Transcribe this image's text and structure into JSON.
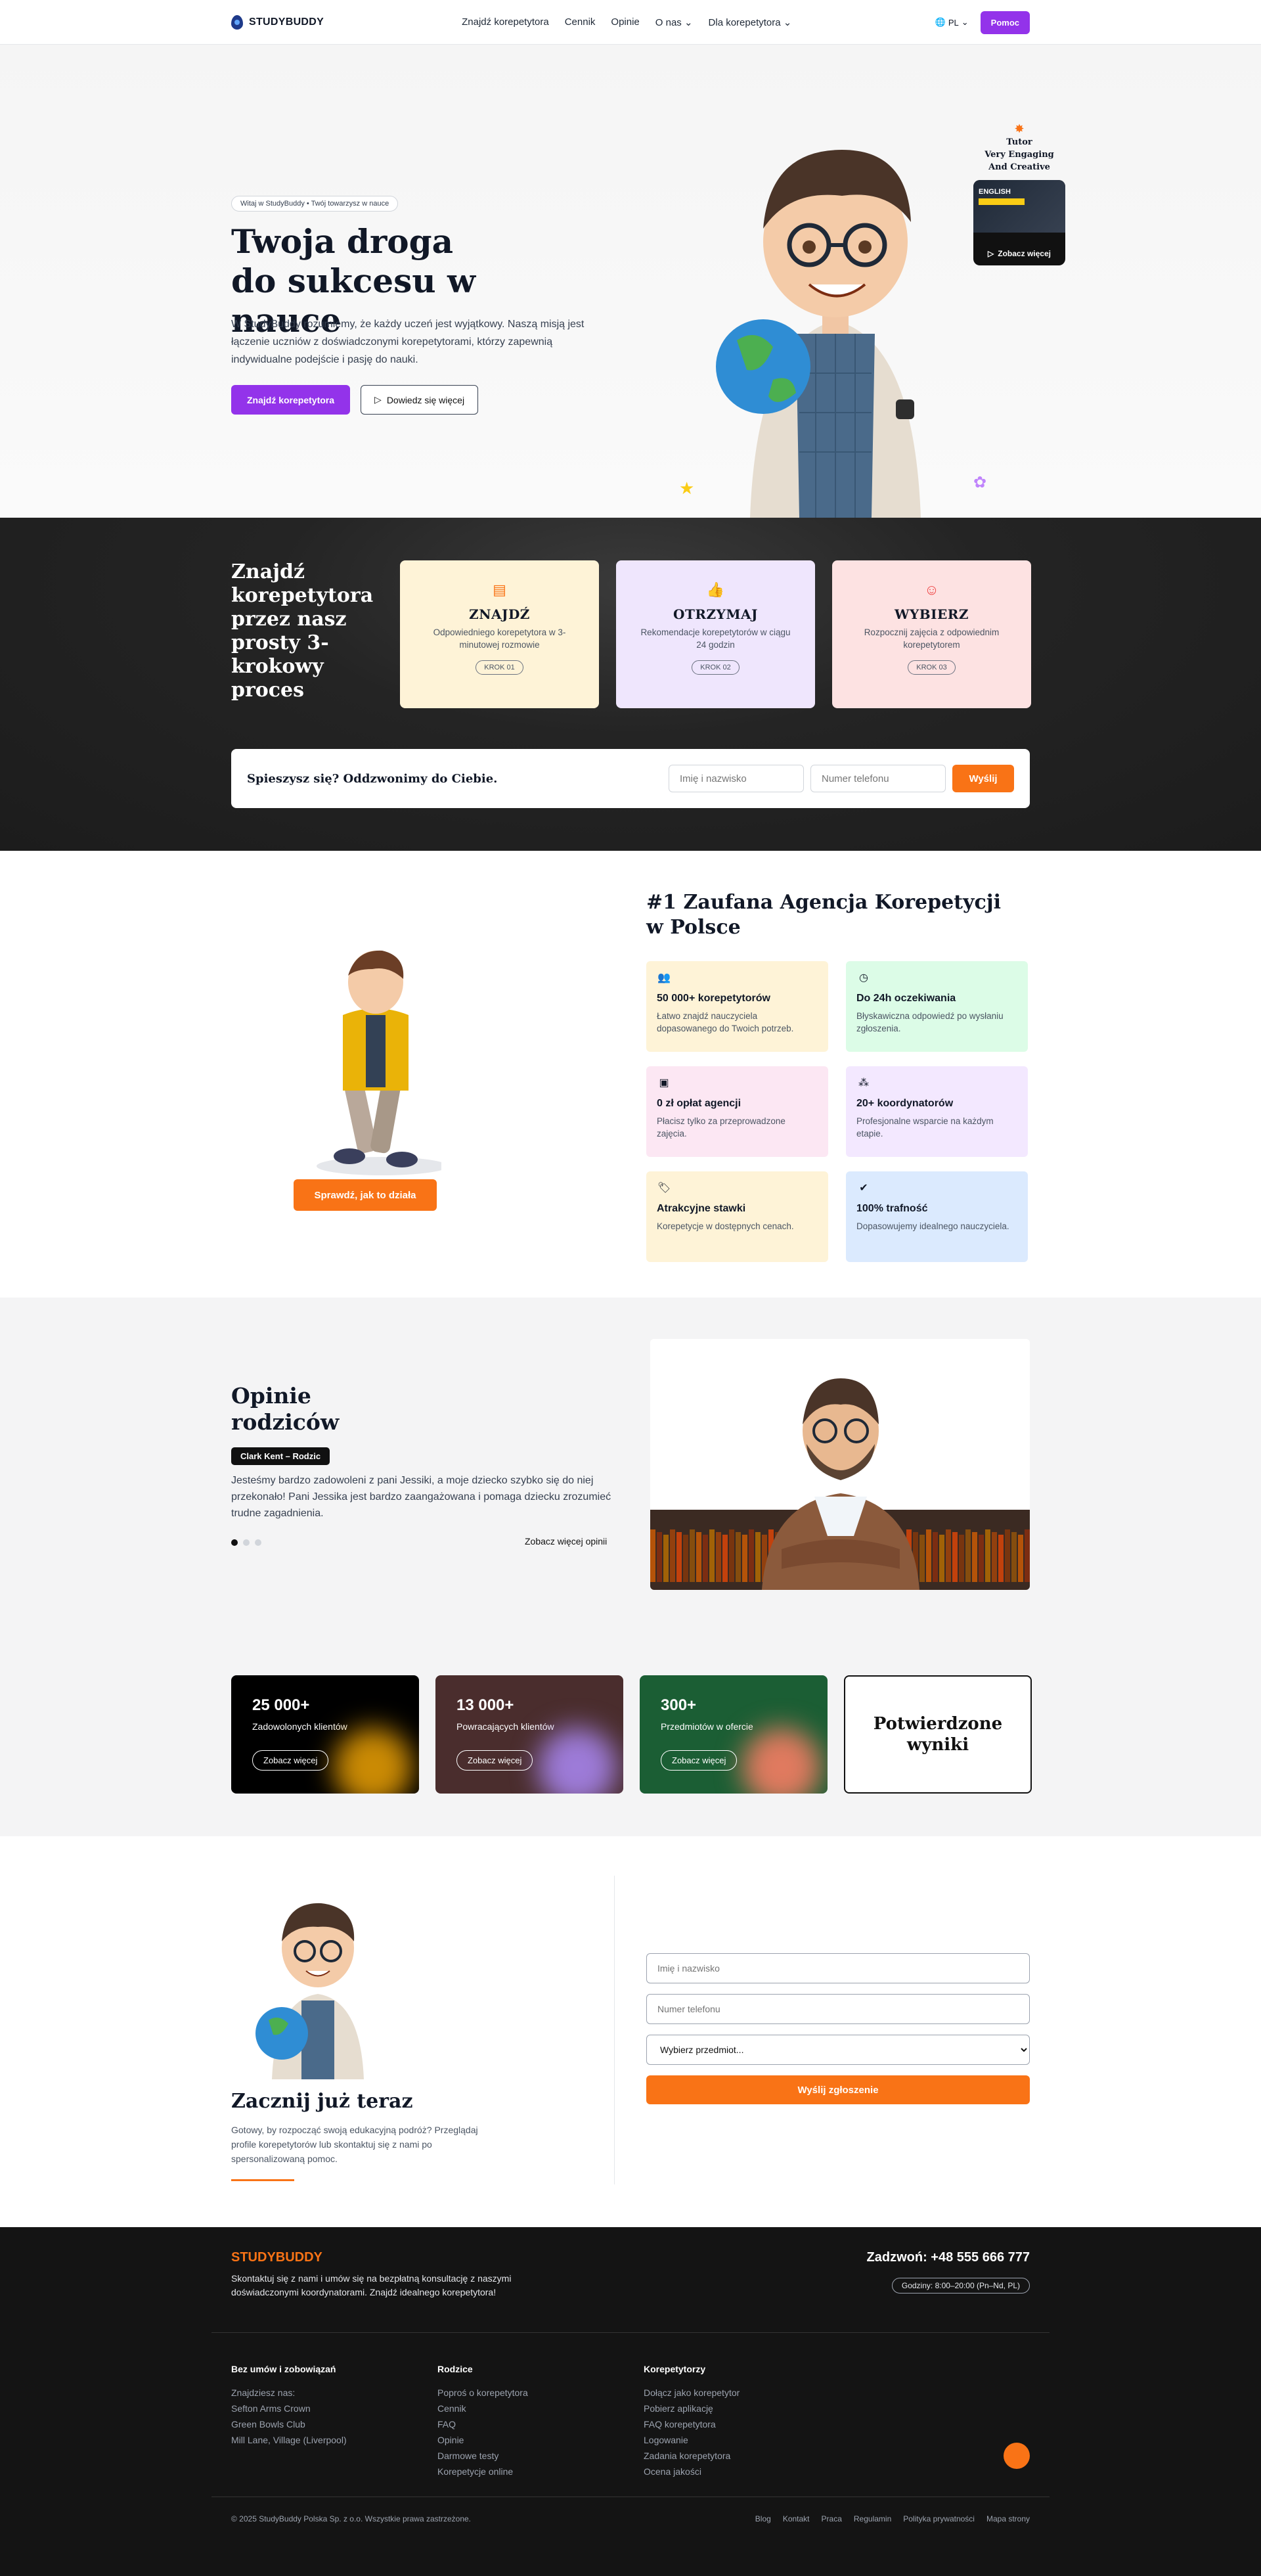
{
  "nav": {
    "brand": "STUDYBUDDY",
    "items": [
      "Znajdź korepetytora",
      "Cennik",
      "Opinie",
      "O nas ⌄",
      "Dla korepetytora ⌄"
    ],
    "lang": "PL",
    "help": "Pomoc"
  },
  "hero": {
    "pill": "Witaj w StudyBuddy • Twój towarzysz w nauce",
    "title_line1": "Twoja droga",
    "title_line2": "do sukcesu w nauce",
    "lead": "W StudyBuddy rozumiemy, że każdy uczeń jest wyjątkowy. Naszą misją jest łączenie uczniów z doświadczonymi korepetytorami, którzy zapewnią indywidualne podejście i pasję do nauki.",
    "cta_primary": "Znajdź korepetytora",
    "cta_secondary": "Dowiedz się więcej",
    "tutor_card": {
      "line1": "Tutor",
      "line2": "Very Engaging",
      "line3": "And Creative",
      "thumb_text": "ENGLISH",
      "more": "Zobacz więcej"
    }
  },
  "steps": {
    "title": "Znajdź korepetytora przez nasz prosty 3-krokowy proces",
    "cards": [
      {
        "title": "ZNAJDŹ",
        "desc": "Odpowiedniego korepetytora w 3-minutowej rozmowie",
        "step": "KROK 01",
        "bg": "#fef3d7",
        "icon": "document-icon",
        "color": "#f97316"
      },
      {
        "title": "OTRZYMAJ",
        "desc": "Rekomendacje korepetytorów w ciągu 24 godzin",
        "step": "KROK 02",
        "bg": "#efe6fd",
        "icon": "thumbs-up-icon",
        "color": "#8b5cf6"
      },
      {
        "title": "WYBIERZ",
        "desc": "Rozpocznij zajęcia z odpowiednim korepetytorem",
        "step": "KROK 03",
        "bg": "#fde2e2",
        "icon": "smile-icon",
        "color": "#ef4444"
      }
    ],
    "callback": {
      "question": "Spieszysz się? Oddzwonimy do Ciebie.",
      "name_placeholder": "Imię i nazwisko",
      "phone_placeholder": "Numer telefonu",
      "submit": "Wyślij"
    }
  },
  "agency": {
    "cta": "Sprawdź, jak to działa",
    "title_line1": "#1 Zaufana Agencja Korepetycji",
    "title_line2": "w Polsce",
    "features": [
      {
        "title": "50 000+ korepetytorów",
        "desc": "Łatwo znajdź nauczyciela dopasowanego do Twoich potrzeb.",
        "bg": "#fef3d7",
        "icon": "users-icon"
      },
      {
        "title": "Do 24h oczekiwania",
        "desc": "Błyskawiczna odpowiedź po wysłaniu zgłoszenia.",
        "bg": "#dcfce7",
        "icon": "clock-icon"
      },
      {
        "title": "0 zł opłat agencji",
        "desc": "Płacisz tylko za przeprowadzone zajęcia.",
        "bg": "#fce7f3",
        "icon": "money-icon"
      },
      {
        "title": "20+ koordynatorów",
        "desc": "Profesjonalne wsparcie na każdym etapie.",
        "bg": "#f3e8ff",
        "icon": "network-icon"
      },
      {
        "title": "Atrakcyjne stawki",
        "desc": "Korepetycje w dostępnych cenach.",
        "bg": "#fef3d7",
        "icon": "tag-icon"
      },
      {
        "title": "100% trafność",
        "desc": "Dopasowujemy idealnego nauczyciela.",
        "bg": "#dbeafe",
        "icon": "check-circle-icon"
      }
    ]
  },
  "opinions": {
    "title_line1": "Opinie",
    "title_line2": "rodziców",
    "author": "Clark Kent – Rodzic",
    "quote": "Jesteśmy bardzo zadowoleni z pani Jessiki, a moje dziecko szybko się do niej przekonało! Pani Jessika jest bardzo zaangażowana i pomaga dziecku zrozumieć trudne zagadnienia.",
    "see_more": "Zobacz więcej opinii",
    "stats": [
      {
        "value": "25 000+",
        "label": "Zadowolonych klientów",
        "button": "Zobacz więcej",
        "bg": "#000000",
        "glow": "#ca8a04"
      },
      {
        "value": "13 000+",
        "label": "Powracających klientów",
        "button": "Zobacz więcej",
        "bg": "#4a2d2d",
        "glow": "#9d7bd8"
      },
      {
        "value": "300+",
        "label": "Przedmiotów w ofercie",
        "button": "Zobacz więcej",
        "bg": "#1b5e34",
        "glow": "#e07a5f"
      }
    ],
    "verified_line1": "Potwierdzone",
    "verified_line2": "wyniki"
  },
  "start": {
    "title": "Zacznij już teraz",
    "desc": "Gotowy, by rozpocząć swoją edukacyjną podróż? Przeglądaj profile korepetytorów lub skontaktuj się z nami po spersonalizowaną pomoc.",
    "name_placeholder": "Imię i nazwisko",
    "phone_placeholder": "Numer telefonu",
    "subject_selected": "Wybierz przedmiot...",
    "submit": "Wyślij zgłoszenie"
  },
  "footer": {
    "brand": "STUDYBUDDY",
    "desc": "Skontaktuj się z nami i umów się na bezpłatną konsultację z naszymi doświadczonymi koordynatorami. Znajdź idealnego korepetytora!",
    "phone": "Zadzwoń: +48 555 666 777",
    "hours": "Godziny: 8:00–20:00 (Pn–Nd, PL)",
    "col1_title": "Bez umów i zobowiązań",
    "col1_items": [
      "Znajdziesz nas:",
      "Sefton Arms Crown",
      "Green Bowls Club",
      "Mill Lane, Village (Liverpool)"
    ],
    "col2_title": "Rodzice",
    "col2_items": [
      "Poproś o korepetytora",
      "Cennik",
      "FAQ",
      "Opinie",
      "Darmowe testy",
      "Korepetycje online"
    ],
    "col3_title": "Korepetytorzy",
    "col3_items": [
      "Dołącz jako korepetytor",
      "Pobierz aplikację",
      "FAQ korepetytora",
      "Logowanie",
      "Zadania korepetytora",
      "Ocena jakości"
    ],
    "copyright": "© 2025 StudyBuddy Polska Sp. z o.o. Wszystkie prawa zastrzeżone.",
    "links": [
      "Blog",
      "Kontakt",
      "Praca",
      "Regulamin",
      "Polityka prywatności",
      "Mapa strony"
    ]
  }
}
